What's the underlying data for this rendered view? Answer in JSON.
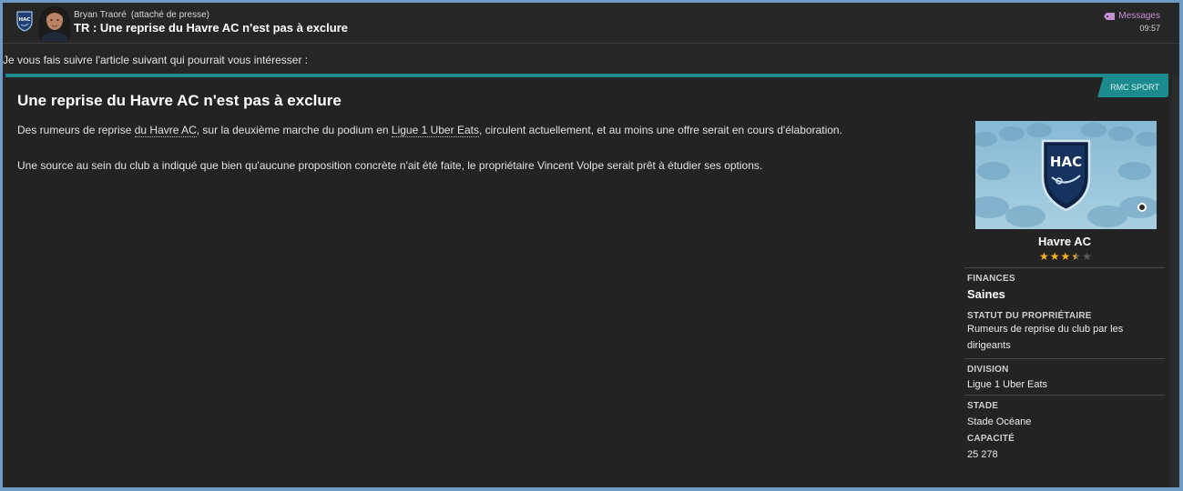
{
  "header": {
    "sender_name": "Bryan Traoré",
    "sender_role": "(attaché de presse)",
    "subject": "TR : Une reprise du Havre AC n'est pas à exclure",
    "messages_link": "Messages",
    "time": "09:57",
    "badge_text": "HAC"
  },
  "intro_text": "Je vous fais suivre l'article suivant qui pourrait vous intéresser :",
  "article": {
    "source": "RMC SPORT",
    "headline": "Une reprise du Havre AC n'est pas à exclure",
    "p1_before": "Des rumeurs de reprise ",
    "p1_link1": "du Havre AC",
    "p1_mid": ", sur la deuxième marche du podium en ",
    "p1_link2": "Ligue 1 Uber Eats",
    "p1_after": ", circulent actuellement, et au moins une offre serait en cours d'élaboration.",
    "p2": "Une source au sein du club a indiqué que bien qu'aucune proposition concrète n'ait été faite, le propriétaire Vincent Volpe serait prêt à étudier ses options."
  },
  "club": {
    "name": "Havre AC",
    "logo_text": "HAC",
    "rating_stars": 3.5,
    "rating_max": 5,
    "finances_label": "FINANCES",
    "finances_value": "Saines",
    "owner_status_label": "STATUT DU PROPRIÉTAIRE",
    "owner_status_value": "Rumeurs de reprise du club par les dirigeants",
    "division_label": "DIVISION",
    "division_value": "Ligue 1 Uber Eats",
    "stadium_label": "STADE",
    "stadium_value": "Stade Océane",
    "capacity_label": "CAPACITÉ",
    "capacity_value": "25 278"
  },
  "colors": {
    "accent_teal": "#1c8b8d",
    "messages_purple": "#c58fd4",
    "star_gold": "#f5b324",
    "background": "#262626",
    "frame_blue": "#6f9ac4"
  }
}
